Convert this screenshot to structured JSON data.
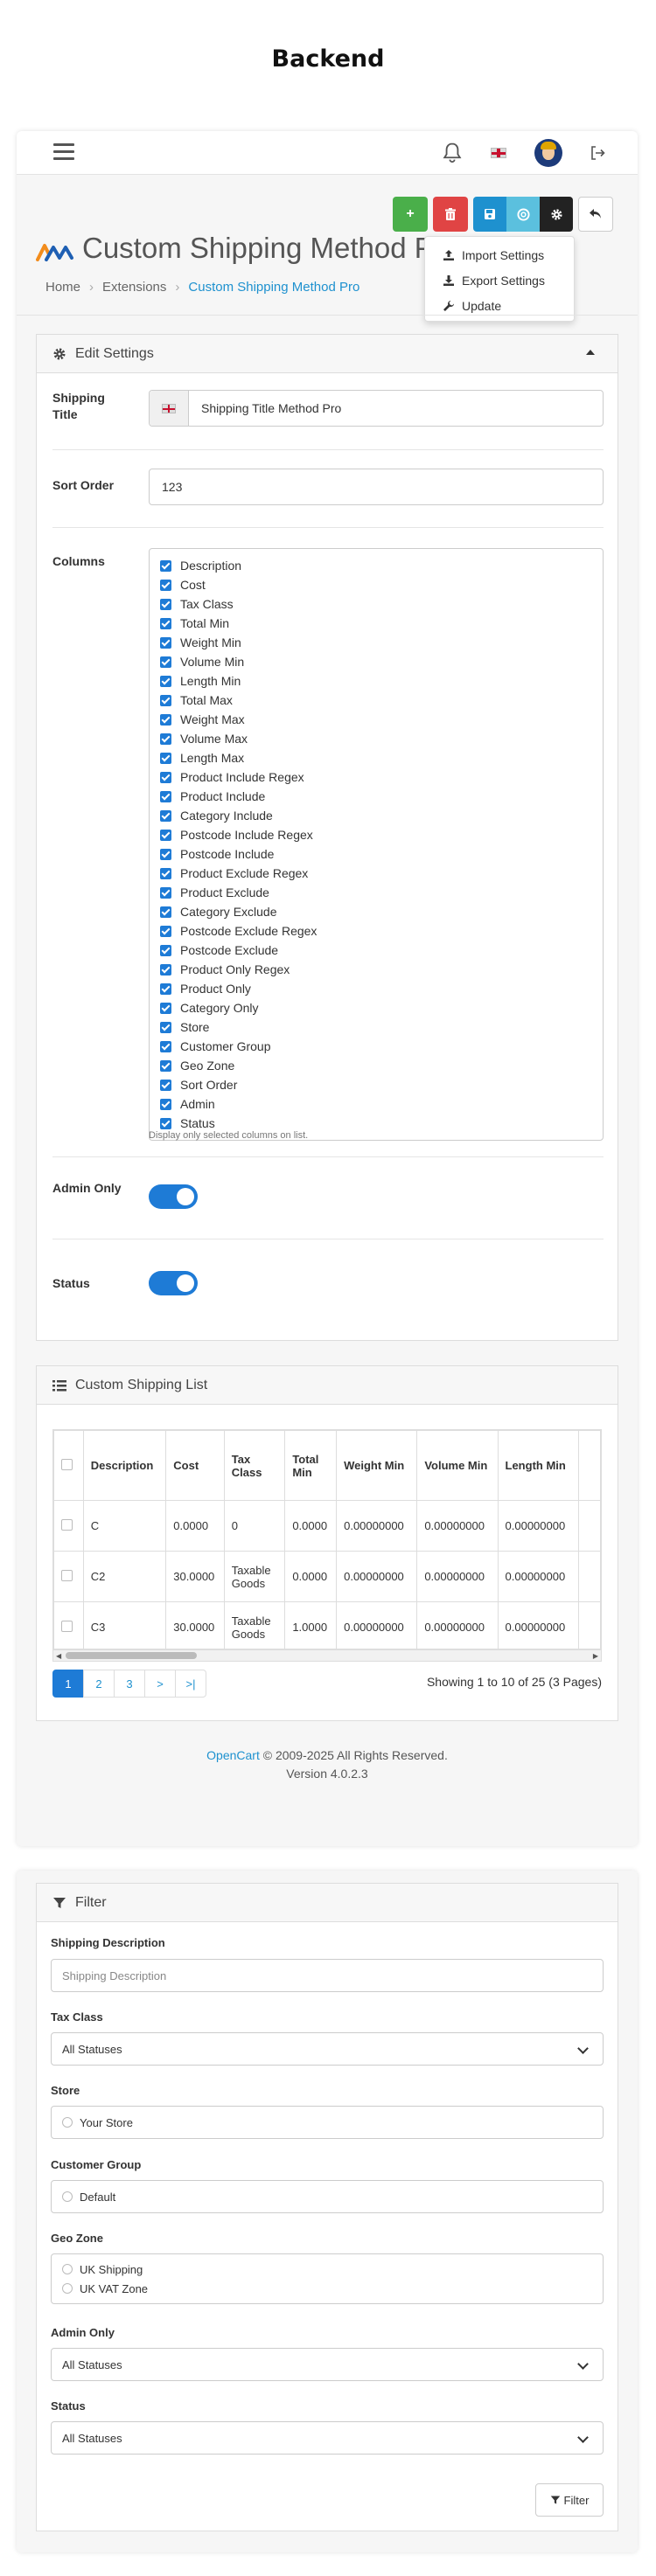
{
  "page": {
    "heading": "Backend"
  },
  "header": {
    "title": "Custom Shipping Method Pro"
  },
  "toolbar": {
    "add": "+",
    "dropdown": [
      "Import Settings",
      "Export Settings",
      "Update"
    ]
  },
  "breadcrumb": [
    "Home",
    "Extensions",
    "Custom Shipping Method Pro"
  ],
  "edit": {
    "title": "Edit Settings",
    "shipping_title_label": "Shipping Title",
    "shipping_title_value": "Shipping Title Method Pro",
    "sort_order_label": "Sort Order",
    "sort_order_value": "123",
    "columns_label": "Columns",
    "columns": [
      "Description",
      "Cost",
      "Tax Class",
      "Total Min",
      "Weight Min",
      "Volume Min",
      "Length Min",
      "Total Max",
      "Weight Max",
      "Volume Max",
      "Length Max",
      "Product Include Regex",
      "Product Include",
      "Category Include",
      "Postcode Include Regex",
      "Postcode Include",
      "Product Exclude Regex",
      "Product Exclude",
      "Category Exclude",
      "Postcode Exclude Regex",
      "Postcode Exclude",
      "Product Only Regex",
      "Product Only",
      "Category Only",
      "Store",
      "Customer Group",
      "Geo Zone",
      "Sort Order",
      "Admin",
      "Status"
    ],
    "columns_help": "Display only selected columns on list.",
    "admin_only_label": "Admin Only",
    "status_label": "Status"
  },
  "list": {
    "title": "Custom Shipping List",
    "headers": [
      "Description",
      "Cost",
      "Tax Class",
      "Total Min",
      "Weight Min",
      "Volume Min",
      "Length Min"
    ],
    "rows": [
      [
        "C",
        "0.0000",
        "0",
        "0.0000",
        "0.00000000",
        "0.00000000",
        "0.00000000"
      ],
      [
        "C2",
        "30.0000",
        "Taxable Goods",
        "0.0000",
        "0.00000000",
        "0.00000000",
        "0.00000000"
      ],
      [
        "C3",
        "30.0000",
        "Taxable Goods",
        "1.0000",
        "0.00000000",
        "0.00000000",
        "0.00000000"
      ]
    ],
    "pages": [
      "1",
      "2",
      "3",
      ">",
      ">|"
    ],
    "showing": "Showing 1 to 10 of 25 (3 Pages)"
  },
  "footer": {
    "link": "OpenCart",
    "copyright": " © 2009-2025 All Rights Reserved.",
    "version": "Version 4.0.2.3"
  },
  "filter": {
    "title": "Filter",
    "shipping_description_label": "Shipping Description",
    "shipping_description_placeholder": "Shipping Description",
    "tax_class_label": "Tax Class",
    "tax_class_value": "All Statuses",
    "store_label": "Store",
    "store_option": "Your Store",
    "customer_group_label": "Customer Group",
    "customer_group_option": "Default",
    "geo_zone_label": "Geo Zone",
    "geo_zone_options": [
      "UK Shipping",
      "UK VAT Zone"
    ],
    "admin_only_label": "Admin Only",
    "admin_only_value": "All Statuses",
    "status_label": "Status",
    "status_value": "All Statuses",
    "button": "Filter"
  },
  "colors": {
    "primary": "#1e7bd6",
    "success": "#4aaf4a",
    "danger": "#e04444",
    "info": "#5bc0de",
    "link": "#1e91cf"
  }
}
